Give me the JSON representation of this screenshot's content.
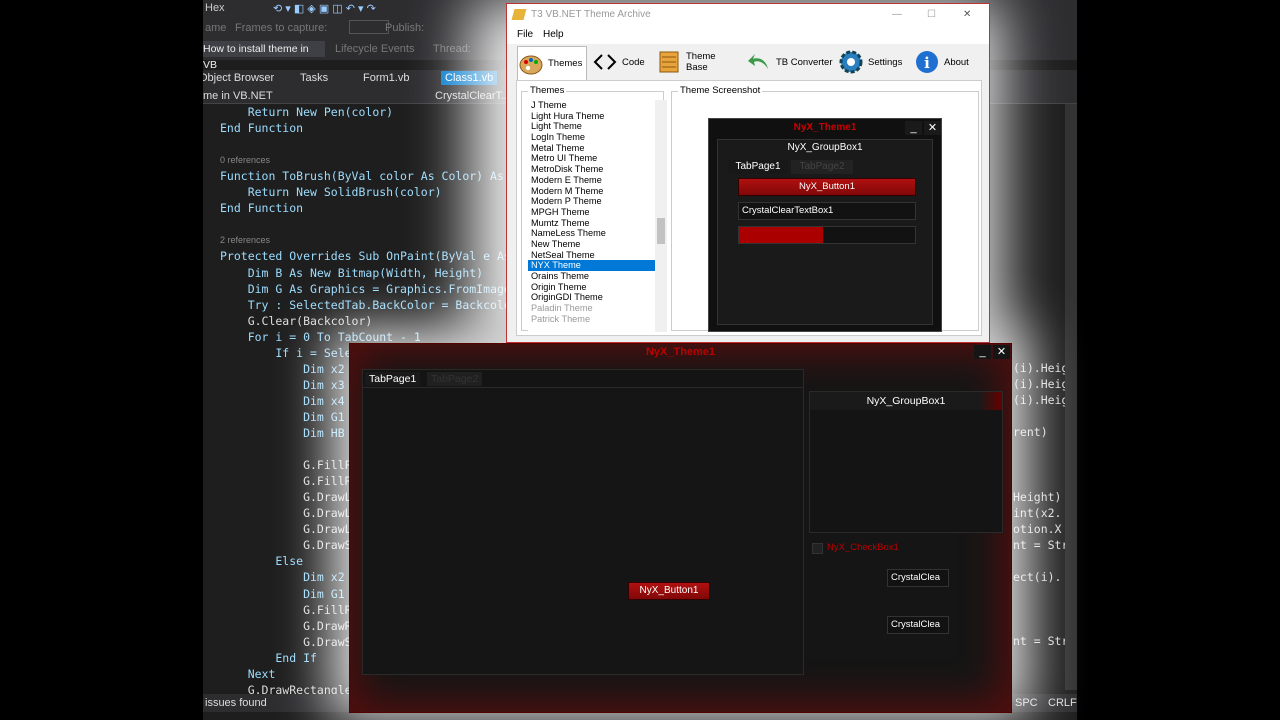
{
  "vs": {
    "toolbar": {
      "hex": "Hex",
      "frames_label": "Frames to capture:",
      "publish": "Publish:"
    },
    "toolbar2": {
      "howto": "How to install theme in VB",
      "lifecycle": "Lifecycle Events",
      "thread": "Thread:",
      "ame": "ame"
    },
    "tabs": [
      "Object Browser",
      "Tasks",
      "Form1.vb",
      "Class1.vb"
    ],
    "nav": {
      "left": "me in VB.NET",
      "right": "CrystalClearT..."
    },
    "code": [
      {
        "t": "    Return New Pen(color)"
      },
      {
        "t": "End Function"
      },
      {
        "t": ""
      },
      {
        "t": "0 references",
        "ref": true
      },
      {
        "t": "Function ToBrush(ByVal color As Color) As"
      },
      {
        "t": "    Return New SolidBrush(color)"
      },
      {
        "t": "End Function"
      },
      {
        "t": ""
      },
      {
        "t": "2 references",
        "ref": true
      },
      {
        "t": "Protected Overrides Sub OnPaint(ByVal e As"
      },
      {
        "t": "    Dim B As New Bitmap(Width, Height)"
      },
      {
        "t": "    Dim G As Graphics = Graphics.FromImage("
      },
      {
        "t": "    Try : SelectedTab.BackColor = Backcolor"
      },
      {
        "t": "    G.Clear(Backcolor)"
      },
      {
        "t": "    For i = 0 To TabCount - 1"
      },
      {
        "t": "        If i = Sele"
      },
      {
        "t": "            Dim x2"
      },
      {
        "t": "            Dim x3"
      },
      {
        "t": "            Dim x4"
      },
      {
        "t": "            Dim G1"
      },
      {
        "t": "            Dim HB"
      },
      {
        "t": ""
      },
      {
        "t": "            G.FillP"
      },
      {
        "t": "            G.FillR"
      },
      {
        "t": "            G.DrawL"
      },
      {
        "t": "            G.DrawL"
      },
      {
        "t": "            G.DrawL"
      },
      {
        "t": "            G.DrawS"
      },
      {
        "t": "        Else"
      },
      {
        "t": "            Dim x2"
      },
      {
        "t": "            Dim G1"
      },
      {
        "t": "            G.FillR"
      },
      {
        "t": "            G.DrawR"
      },
      {
        "t": "            G.DrawS"
      },
      {
        "t": "        End If"
      },
      {
        "t": "    Next"
      },
      {
        "t": "    G.DrawRectangle"
      }
    ],
    "right_snips": [
      "(i).Heig",
      "(i).Heig",
      "(i).Heig",
      "rent)",
      "Height)",
      "int(x2.",
      "otion.X",
      "nt = Str",
      "ect(i).",
      "nt = Str"
    ],
    "status": {
      "left": "issues found",
      "spc": "SPC",
      "crlf": "CRLF"
    }
  },
  "archive": {
    "title": "T3 VB.NET Theme Archive",
    "menu": [
      "File",
      "Help"
    ],
    "tabs": [
      {
        "label": "Themes",
        "icon": "palette-icon"
      },
      {
        "label": "Code",
        "icon": "code-brackets-icon"
      },
      {
        "label": "Theme Base",
        "icon": "book-icon"
      },
      {
        "label": "TB Converter",
        "icon": "green-arrow-icon"
      },
      {
        "label": "Settings",
        "icon": "gear-icon"
      },
      {
        "label": "About",
        "icon": "info-icon"
      }
    ],
    "themes_group": "Themes",
    "screenshot_group": "Theme Screenshot",
    "themes": [
      "J Theme",
      "Light Hura Theme",
      "Light Theme",
      "LogIn Theme",
      "Metal Theme",
      "Metro UI Theme",
      "MetroDisk Theme",
      "Modern E Theme",
      "Modern M Theme",
      "Modern P Theme",
      "MPGH Theme",
      "Mumtz Theme",
      "NameLess Theme",
      "New Theme",
      "NetSeal Theme",
      "NYX Theme",
      "Orains Theme",
      "Origin Theme",
      "OriginGDI Theme",
      "Paladin Theme",
      "Patrick Theme"
    ],
    "selected_theme": "NYX Theme",
    "preview": {
      "title": "NyX_Theme1",
      "groupbox": "NyX_GroupBox1",
      "tab1": "TabPage1",
      "tab2": "TabPage2",
      "button": "NyX_Button1",
      "textbox": "CrystalClearTextBox1",
      "progress": 0.48
    }
  },
  "nyx": {
    "title": "NyX_Theme1",
    "tab1": "TabPage1",
    "tab2": "TabPage2",
    "button": "NyX_Button1",
    "groupbox": "NyX_GroupBox1",
    "checkbox": "NyX_CheckBox1",
    "cc1": "CrystalClea",
    "cc2": "CrystalClea"
  }
}
